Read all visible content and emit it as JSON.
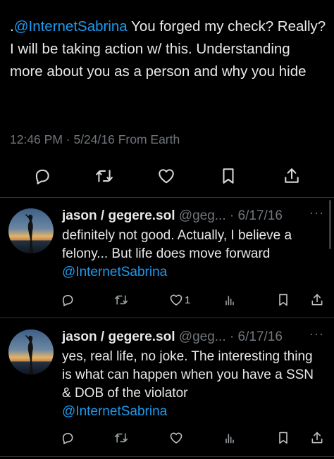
{
  "main_tweet": {
    "prefix": ".",
    "mention": "@InternetSabrina",
    "text": " You forged my check? Really? I will be taking action w/ this. Understanding more about you as a person and why you hide",
    "timestamp": "12:46 PM · 5/24/16 From Earth",
    "actions": [
      "reply-icon",
      "retweet-icon",
      "like-icon",
      "bookmark-icon",
      "share-icon"
    ]
  },
  "replies": [
    {
      "name": "jason / gegere.sol",
      "handle": "@geg...",
      "date": "· 6/17/16",
      "more": "···",
      "text": "definitely not good. Actually, I believe a felony... But life does move forward",
      "mention": "@InternetSabrina",
      "likes": "1",
      "retweets": "",
      "replies": ""
    },
    {
      "name": "jason / gegere.sol",
      "handle": "@geg...",
      "date": "· 6/17/16",
      "more": "···",
      "text": "yes, real life, no joke. The interesting thing is what can happen when you have a SSN & DOB of the violator",
      "mention": "@InternetSabrina",
      "likes": "",
      "retweets": "",
      "replies": ""
    }
  ],
  "colors": {
    "background": "#000000",
    "text": "#e7e9ea",
    "muted": "#71767b",
    "link": "#1d9bf0",
    "divider": "#2f3336"
  }
}
